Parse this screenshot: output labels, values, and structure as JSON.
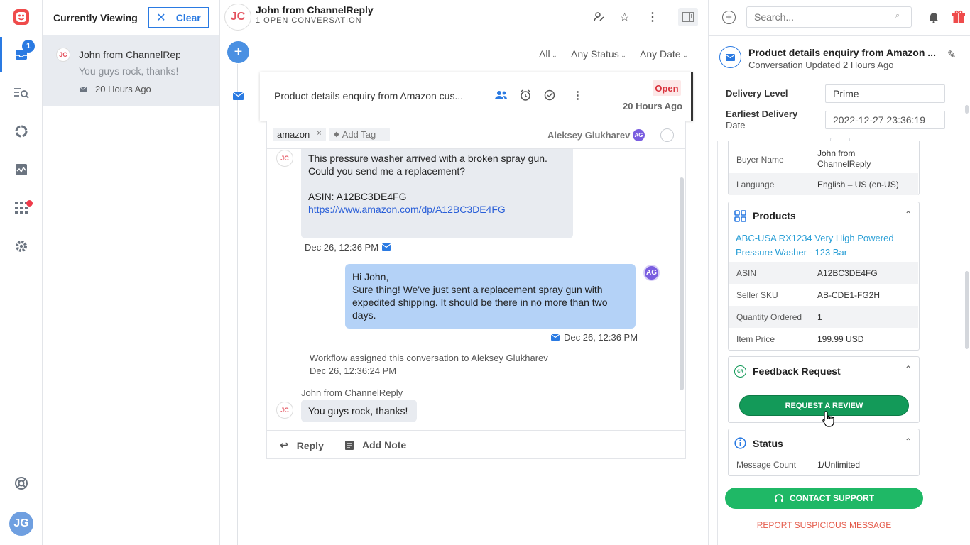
{
  "rail": {
    "inbox_badge": "1",
    "avatar_initials": "JG"
  },
  "list": {
    "title": "Currently Viewing",
    "clear_label": "Clear",
    "item": {
      "initials": "JC",
      "name": "John from ChannelReply",
      "preview": "You guys rock, thanks!",
      "time": "20 Hours Ago"
    }
  },
  "header": {
    "initials": "JC",
    "title": "John from ChannelReply",
    "subtitle": "1 OPEN CONVERSATION"
  },
  "filters": {
    "all": "All",
    "status": "Any Status",
    "date": "Any Date"
  },
  "card": {
    "subject": "Product details enquiry from Amazon cus...",
    "status": "Open",
    "time": "20 Hours Ago"
  },
  "tags": {
    "tag": "amazon",
    "add_tag": "Add Tag",
    "assignee": "Aleksey Glukharev",
    "assignee_initials": "AG"
  },
  "messages": {
    "m1_initials": "JC",
    "m1_line1": "This pressure washer arrived with a broken spray gun.",
    "m1_line2": "Could you send me a replacement?",
    "m1_line3": "ASIN: A12BC3DE4FG",
    "m1_link": "https://www.amazon.com/dp/A12BC3DE4FG",
    "m1_time": "Dec 26, 12:36 PM",
    "m2_initials": "AG",
    "m2_line1": "Hi John,",
    "m2_line2": "Sure thing! We've just sent a replacement spray gun with",
    "m2_line3": "expedited shipping. It should be there in no more than two",
    "m2_line4": "days.",
    "m2_time": "Dec 26, 12:36 PM",
    "workflow_text": "Workflow assigned this conversation to Aleksey Glukharev",
    "workflow_time": "Dec 26, 12:36:24 PM",
    "m3_author": "John from ChannelReply",
    "m3_initials": "JC",
    "m3_text": "You guys rock, thanks!"
  },
  "reply_bar": {
    "reply": "Reply",
    "note": "Add Note"
  },
  "right": {
    "search_placeholder": "Search...",
    "conv_title": "Product details enquiry from Amazon ...",
    "conv_sub": "Conversation Updated 2 Hours Ago",
    "delivery_level_label": "Delivery Level",
    "delivery_level_value": "Prime",
    "earliest_label1": "Earliest Delivery",
    "earliest_label2": "Date",
    "earliest_value": "2022-12-27 23:36:19",
    "buyer_label": "Buyer Name",
    "buyer_value1": "John from",
    "buyer_value2": "ChannelReply",
    "language_label": "Language",
    "language_value": "English – US (en-US)",
    "products_title": "Products",
    "product_link1": "ABC-USA RX1234 Very High Powered",
    "product_link2": "Pressure Washer - 123 Bar",
    "asin_label": "ASIN",
    "asin_value": "A12BC3DE4FG",
    "sku_label": "Seller SKU",
    "sku_value": "AB-CDE1-FG2H",
    "qty_label": "Quantity Ordered",
    "qty_value": "1",
    "price_label": "Item Price",
    "price_value": "199.99 USD",
    "feedback_title": "Feedback Request",
    "request_btn": "REQUEST A REVIEW",
    "status_title": "Status",
    "msgcount_label": "Message Count",
    "msgcount_value": "1/Unlimited",
    "contact_btn": "CONTACT SUPPORT",
    "report_link": "REPORT SUSPICIOUS MESSAGE"
  }
}
